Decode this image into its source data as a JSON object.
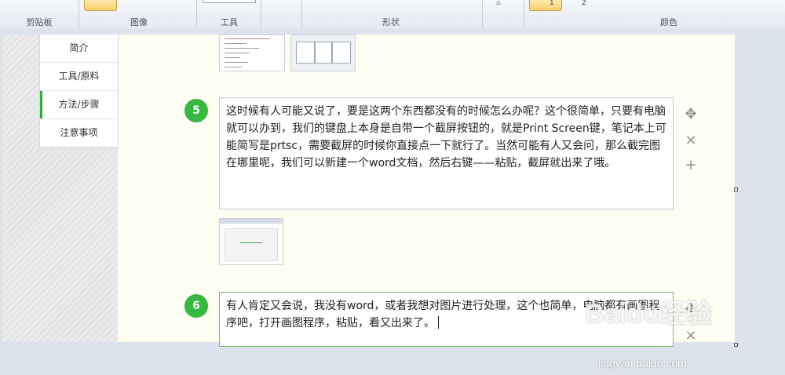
{
  "ribbon": {
    "groups": [
      "剪贴板",
      "图像",
      "工具",
      "形状",
      "颜色"
    ],
    "mini_labels": [
      "1",
      "2"
    ]
  },
  "nav": {
    "items": [
      {
        "label": "简介"
      },
      {
        "label": "工具/原料"
      },
      {
        "label": "方法/步骤"
      },
      {
        "label": "注意事项"
      }
    ]
  },
  "steps": [
    {
      "number": "5",
      "text": "这时候有人可能又说了，要是这两个东西都没有的时候怎么办呢？这个很简单，只要有电脑就可以办到，我们的键盘上本身是自带一个截屏按钮的，就是Print Screen键，笔记本上可能简写是prtsc，需要截屏的时候你直接点一下就行了。当然可能有人又会问，那么截完图在哪里呢，我们可以新建一个word文档，然后右键——粘贴，截屏就出来了哦。"
    },
    {
      "number": "6",
      "text": "有人肯定又会说，我没有word，或者我想对图片进行处理，这个也简单，电脑都有画图程序吧，打开画图程序，粘贴，看又出来了。"
    }
  ],
  "watermark": {
    "logo": "Baidu经验",
    "url": "jingyan.baidu.com"
  },
  "icons": {
    "move": "move-icon",
    "delete": "close-icon",
    "add": "plus-icon"
  },
  "colors": {
    "accent": "#35b93f",
    "page_bg": "#fefef3"
  }
}
